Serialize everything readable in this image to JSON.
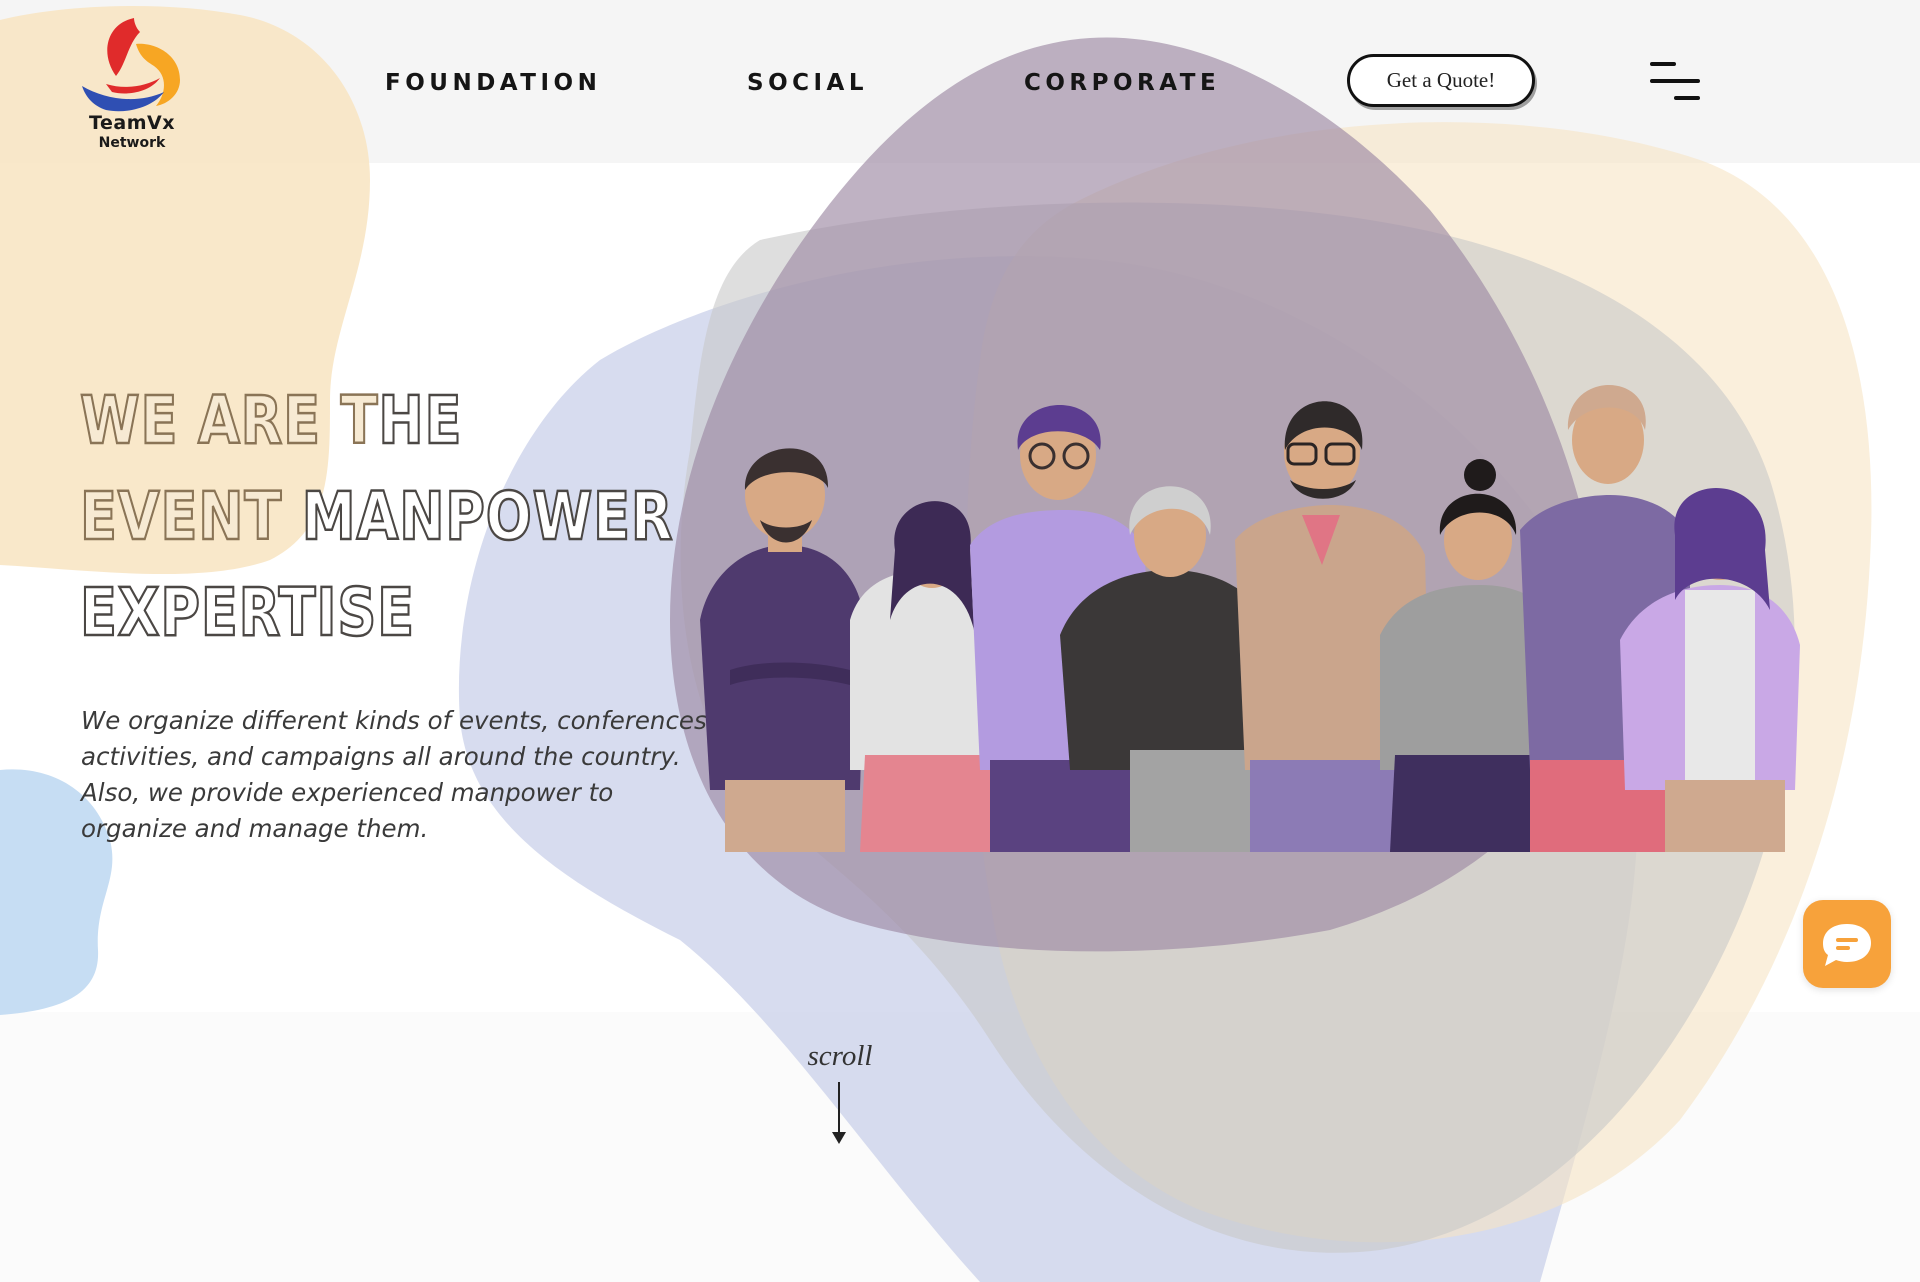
{
  "brand": {
    "name": "TeamVx",
    "subtitle": "Network",
    "logo_colors": [
      "#e02b2b",
      "#f7a623",
      "#2f4fb3"
    ]
  },
  "nav": {
    "items": [
      {
        "label": "FOUNDATION"
      },
      {
        "label": "SOCIAL"
      },
      {
        "label": "CORPORATE"
      }
    ],
    "cta_label": "Get a Quote!",
    "menu_icon": "hamburger-menu-icon"
  },
  "hero": {
    "headline": {
      "line1": {
        "part1": "WE ARE",
        "part2": "T",
        "part3": "HE"
      },
      "line2": {
        "part1": "EVENT",
        "part2": "MANPOW",
        "part3": "ER"
      },
      "line3": {
        "part1": "EXPERTISE"
      }
    },
    "description": "We organize different kinds of events, conferences, activities, and campaigns all around the country. Also, we provide experienced manpower to organize and manage them.",
    "illustration_icon": "team-group-illustration"
  },
  "scroll": {
    "label": "scroll",
    "icon": "arrow-down-icon"
  },
  "chat": {
    "icon": "chat-bubble-icon",
    "color": "#f7a23b"
  },
  "colors": {
    "header_bg": "#f5f5f5",
    "blob_peach": "#f6e2bd",
    "blob_purple": "#a592ab",
    "blob_lavender": "#c9cee8",
    "blob_grey": "#cfcfcf",
    "blob_blue": "#bcd8f1"
  }
}
